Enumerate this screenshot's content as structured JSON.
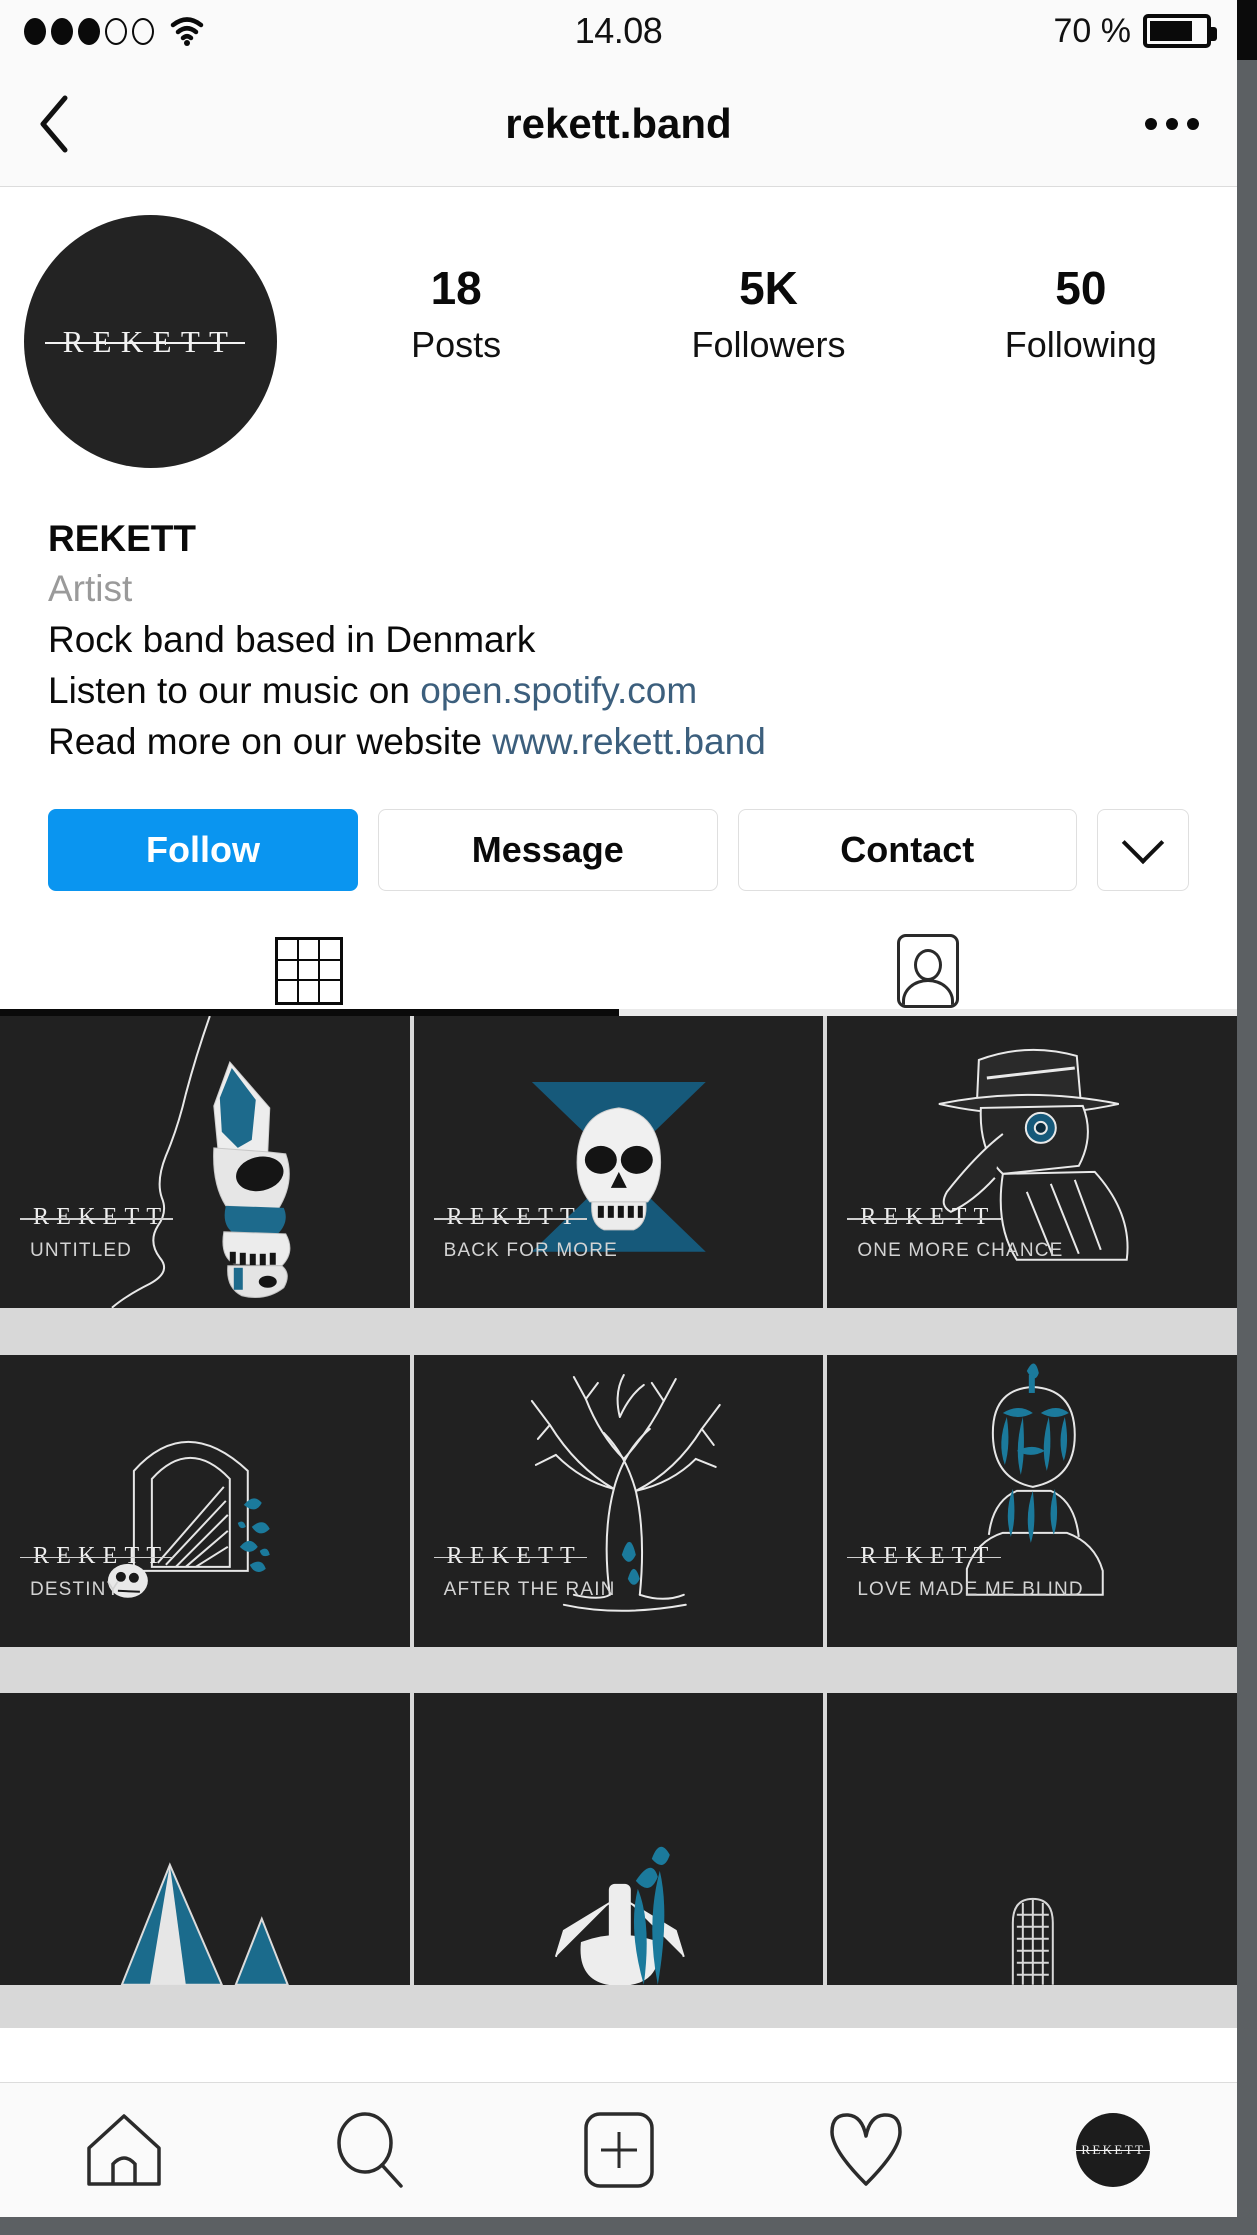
{
  "status_bar": {
    "signal_dots_filled": 3,
    "signal_dots_total": 5,
    "wifi_icon": "wifi-icon",
    "time": "14.08",
    "battery_percent": "70 %",
    "battery_level": 70
  },
  "nav": {
    "back_icon": "back-chevron-icon",
    "title": "rekett.band",
    "more_icon": "more-options-icon"
  },
  "profile": {
    "avatar_logo": "REKETT",
    "stats": [
      {
        "value": "18",
        "label": "Posts"
      },
      {
        "value": "5K",
        "label": "Followers"
      },
      {
        "value": "50",
        "label": "Following"
      }
    ],
    "display_name": "REKETT",
    "category": "Artist",
    "bio_line_1": "Rock band based in Denmark",
    "bio_line_2_prefix": "Listen to our music on ",
    "bio_line_2_link": "open.spotify.com",
    "bio_line_3_prefix": "Read more on our website ",
    "bio_line_3_link": "www.rekett.band",
    "link_color": "#3c5f7d"
  },
  "actions": {
    "follow": "Follow",
    "message": "Message",
    "contact": "Contact",
    "more_caret_icon": "chevron-down-icon",
    "follow_color": "#0a95f0"
  },
  "tabs": [
    {
      "name": "grid-tab",
      "icon": "grid-icon",
      "active": true
    },
    {
      "name": "tagged-tab",
      "icon": "tagged-person-icon",
      "active": false
    }
  ],
  "posts": [
    {
      "logo": "REKETT",
      "title": "UNTITLED",
      "art": "skull-profile"
    },
    {
      "logo": "REKETT",
      "title": "BACK FOR MORE",
      "art": "skull-hourglass"
    },
    {
      "logo": "REKETT",
      "title": "ONE MORE CHANCE",
      "art": "plague-doctor"
    },
    {
      "logo": "REKETT",
      "title": "DESTINY",
      "art": "gravestone-skull"
    },
    {
      "logo": "REKETT",
      "title": "AFTER THE RAIN",
      "art": "bare-tree"
    },
    {
      "logo": "REKETT",
      "title": "LOVE MADE ME BLIND",
      "art": "melting-head"
    },
    {
      "logo": "",
      "title": "",
      "art": "mountains"
    },
    {
      "logo": "",
      "title": "",
      "art": "skeleton-flowers"
    },
    {
      "logo": "",
      "title": "",
      "art": "microphone"
    }
  ],
  "bottom_nav": [
    {
      "name": "home-nav",
      "icon": "home-icon"
    },
    {
      "name": "search-nav",
      "icon": "search-icon"
    },
    {
      "name": "create-nav",
      "icon": "plus-square-icon"
    },
    {
      "name": "activity-nav",
      "icon": "heart-icon"
    },
    {
      "name": "profile-nav",
      "icon": "profile-avatar-icon",
      "label": "REKETT"
    }
  ],
  "colors": {
    "accent_teal": "#16597a",
    "tile_bg": "#212121",
    "instagram_blue": "#0a95f0"
  }
}
